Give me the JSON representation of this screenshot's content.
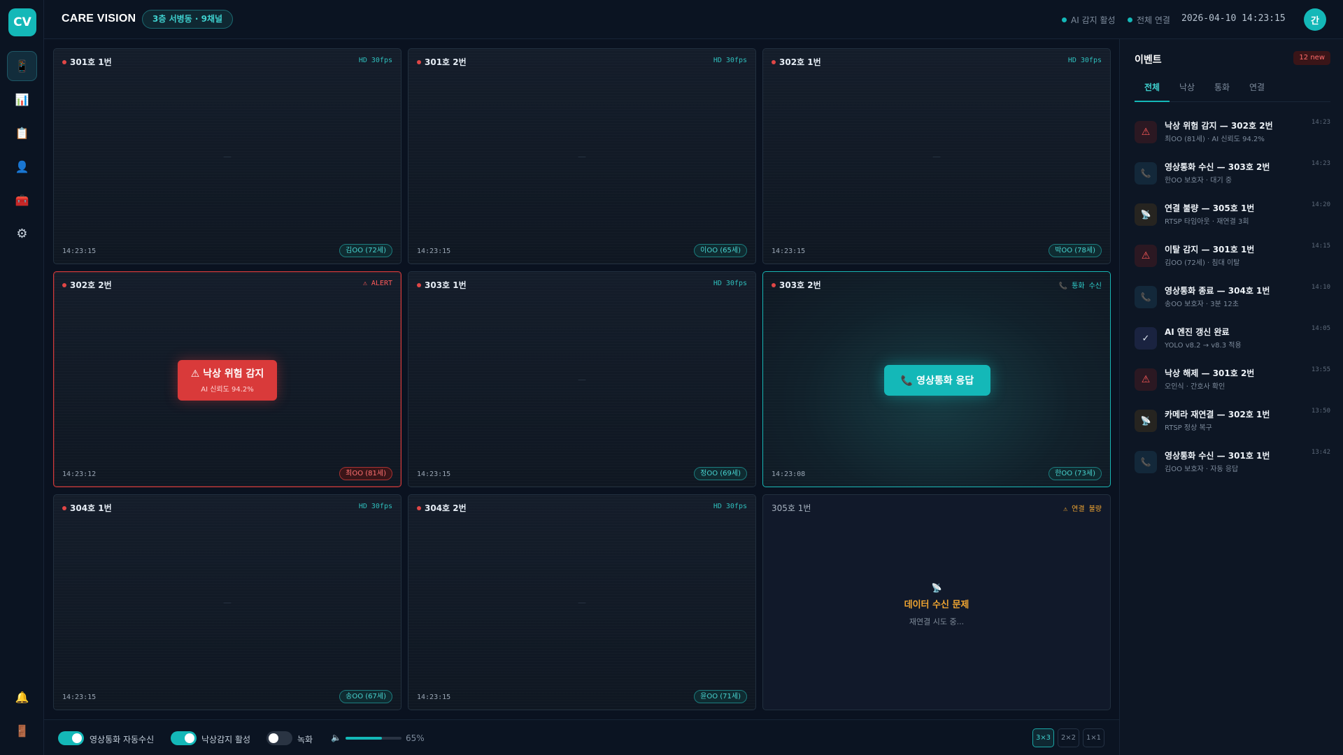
{
  "sidebar": {
    "logo": "CV",
    "items": [
      {
        "name": "monitor",
        "glyph": "📱"
      },
      {
        "name": "stats",
        "glyph": "📊"
      },
      {
        "name": "records",
        "glyph": "📋"
      },
      {
        "name": "patients",
        "glyph": "👤"
      },
      {
        "name": "devices",
        "glyph": "🧰"
      },
      {
        "name": "settings",
        "glyph": "⚙"
      }
    ],
    "bottom": [
      {
        "name": "bell",
        "glyph": "🔔"
      },
      {
        "name": "logout",
        "glyph": "🚪"
      }
    ]
  },
  "header": {
    "title": "CARE VISION",
    "ward_badge": "3층 서병동 · 9채널",
    "ai_status": "AI 감지 활성",
    "connection_status": "전체 연결",
    "datetime": "2026-04-10 14:23:15",
    "avatar": "간",
    "accent": "#14b8b8"
  },
  "cameras": [
    {
      "name": "301호 1번",
      "status": "HD 30fps",
      "time": "14:23:15",
      "patient": "김OO (72세)",
      "state": "normal"
    },
    {
      "name": "301호 2번",
      "status": "HD 30fps",
      "time": "14:23:15",
      "patient": "이OO (65세)",
      "state": "normal"
    },
    {
      "name": "302호 1번",
      "status": "HD 30fps",
      "time": "14:23:15",
      "patient": "박OO (78세)",
      "state": "normal"
    },
    {
      "name": "302호 2번",
      "status": "⚠ ALERT",
      "time": "14:23:12",
      "patient": "최OO (81세)",
      "state": "alert"
    },
    {
      "name": "303호 1번",
      "status": "HD 30fps",
      "time": "14:23:15",
      "patient": "정OO (69세)",
      "state": "normal"
    },
    {
      "name": "303호 2번",
      "status": "📞 통화 수신",
      "time": "14:23:08",
      "patient": "한OO (73세)",
      "state": "call"
    },
    {
      "name": "304호 1번",
      "status": "HD 30fps",
      "time": "14:23:15",
      "patient": "송OO (67세)",
      "state": "normal"
    },
    {
      "name": "304호 2번",
      "status": "HD 30fps",
      "time": "14:23:15",
      "patient": "윤OO (71세)",
      "state": "normal"
    },
    {
      "name": "305호 1번",
      "status": "⚠ 연결 불량",
      "time": "",
      "patient": "",
      "state": "offline"
    }
  ],
  "alert_overlay": {
    "title": "⚠ 낙상 위험 감지",
    "sub": "AI 신뢰도 94.2%"
  },
  "call_overlay": {
    "label": "📞 영상통화 응답"
  },
  "offline_overlay": {
    "icon": "📡",
    "title": "데이터 수신 문제",
    "sub": "재연결 시도 중..."
  },
  "bottombar": {
    "toggles": [
      {
        "label": "영상통화 자동수신",
        "on": true
      },
      {
        "label": "낙상감지 활성",
        "on": true
      },
      {
        "label": "녹화",
        "on": false
      }
    ],
    "volume_icon": "🔈",
    "volume_percent": 65,
    "volume_text": "65%",
    "layouts": [
      "3×3",
      "2×2",
      "1×1"
    ],
    "active_layout": "3×3"
  },
  "events_panel": {
    "title": "이벤트",
    "new_count": "12 new",
    "tabs": [
      "전체",
      "낙상",
      "통화",
      "연결"
    ],
    "active_tab": "전체",
    "events": [
      {
        "type": "fall",
        "icon": "⚠",
        "title": "낙상 위험 감지 — 302호 2번",
        "sub": "최OO (81세) · AI 신뢰도 94.2%",
        "time": "14:23"
      },
      {
        "type": "call",
        "icon": "📞",
        "title": "영상통화 수신 — 303호 2번",
        "sub": "한OO 보호자 · 대기 중",
        "time": "14:23"
      },
      {
        "type": "conn",
        "icon": "📡",
        "title": "연결 불량 — 305호 1번",
        "sub": "RTSP 타임아웃 · 재연결 3회",
        "time": "14:20"
      },
      {
        "type": "fall",
        "icon": "⚠",
        "title": "이탈 감지 — 301호 1번",
        "sub": "김OO (72세) · 침대 이탈",
        "time": "14:15"
      },
      {
        "type": "call",
        "icon": "📞",
        "title": "영상통화 종료 — 304호 1번",
        "sub": "송OO 보호자 · 3분 12초",
        "time": "14:10"
      },
      {
        "type": "ai",
        "icon": "✓",
        "title": "AI 엔진 갱신 완료",
        "sub": "YOLO v8.2 → v8.3 적용",
        "time": "14:05"
      },
      {
        "type": "fall",
        "icon": "⚠",
        "title": "낙상 해제 — 301호 2번",
        "sub": "오인식 · 간호사 확인",
        "time": "13:55"
      },
      {
        "type": "conn",
        "icon": "📡",
        "title": "카메라 재연결 — 302호 1번",
        "sub": "RTSP 정상 복구",
        "time": "13:50"
      },
      {
        "type": "call",
        "icon": "📞",
        "title": "영상통화 수신 — 301호 1번",
        "sub": "김OO 보호자 · 자동 응답",
        "time": "13:42"
      }
    ]
  }
}
